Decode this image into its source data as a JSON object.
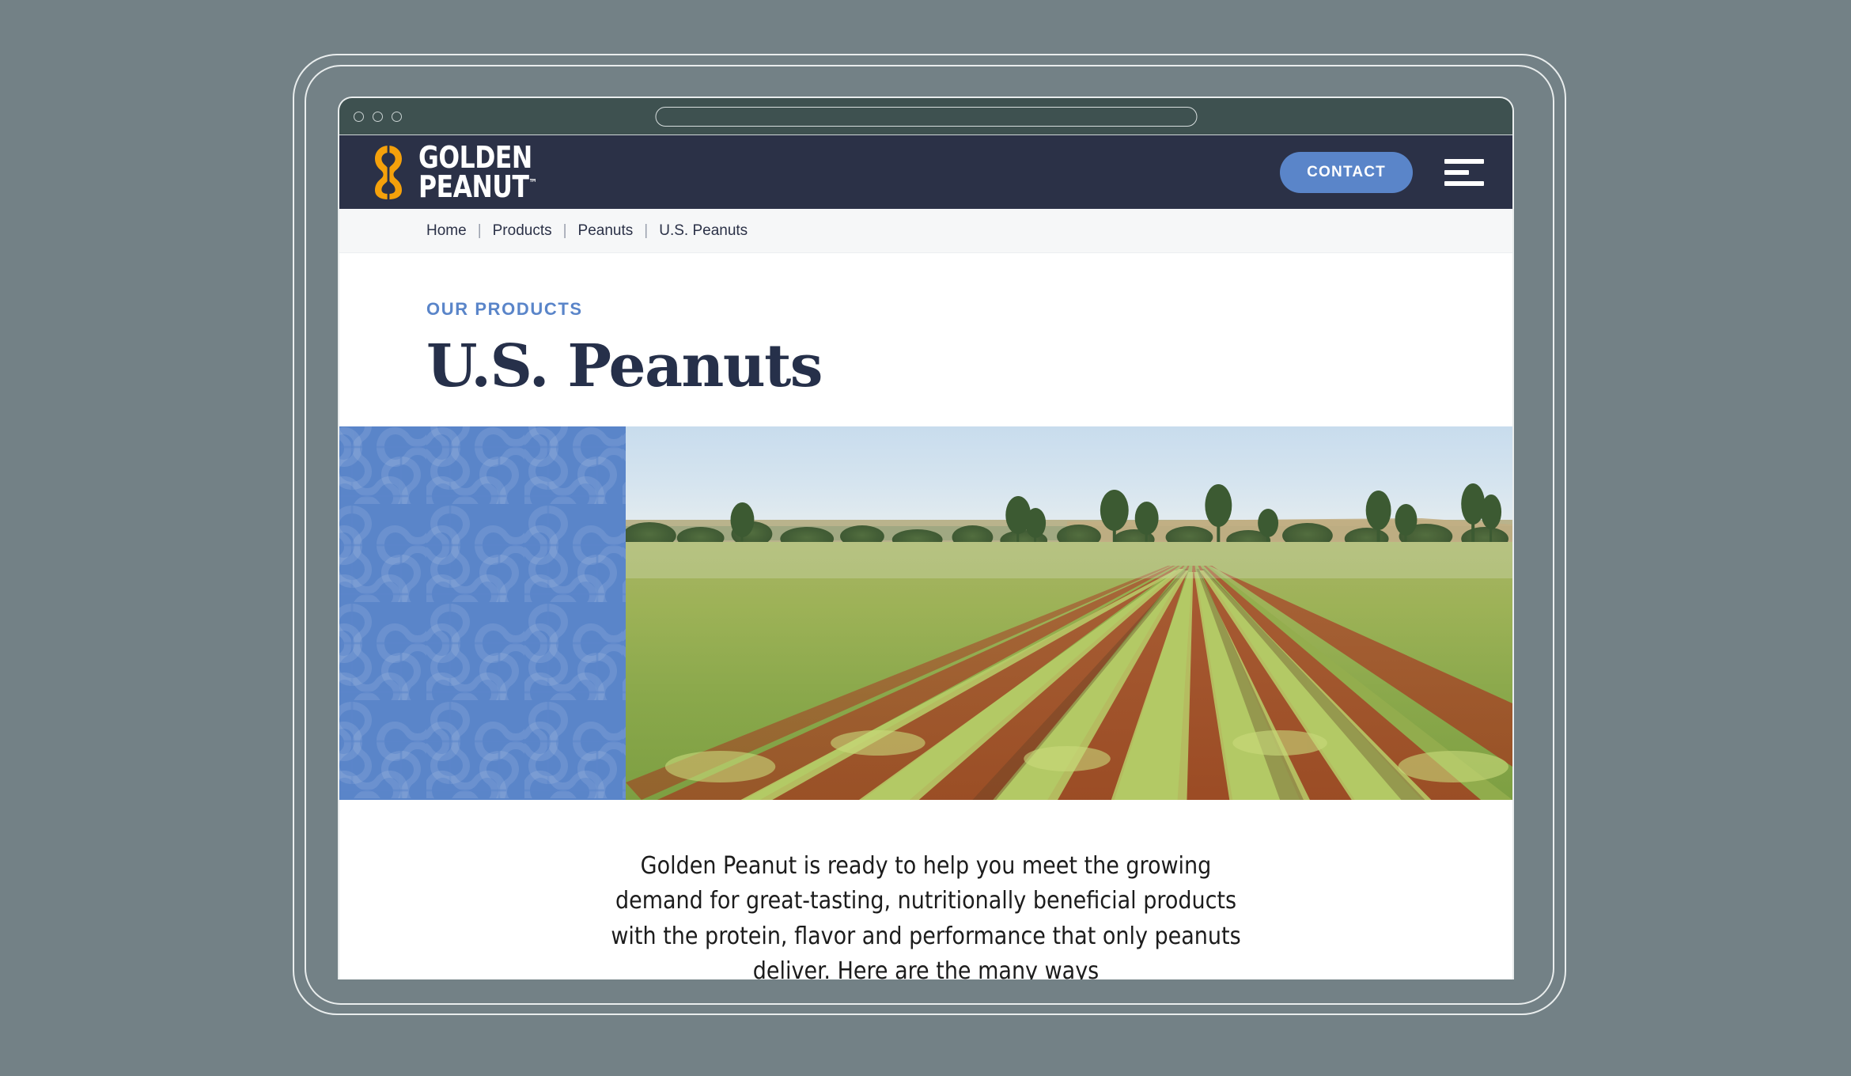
{
  "theme": {
    "page_background": "#738186",
    "device_outline": "#e9eded",
    "browser_chrome": "#3e5150",
    "nav_background": "#2b3147",
    "accent_blue": "#5a85c9",
    "brand_gold": "#f5a10b",
    "heading_navy": "#26304a",
    "breadcrumb_background": "#f6f7f8"
  },
  "browser": {
    "traffic_lights": [
      "window-close-dot",
      "window-minimize-dot",
      "window-maximize-dot"
    ],
    "address_value": "",
    "address_placeholder": ""
  },
  "nav": {
    "brand": {
      "mark": "peanut-logo-icon",
      "line1": "GOLDEN",
      "line2": "PEANUT",
      "trademark": "™"
    },
    "contact_label": "CONTACT",
    "menu_icon": "hamburger-menu-icon"
  },
  "breadcrumb": {
    "separator": "|",
    "items": [
      {
        "label": "Home",
        "current": false
      },
      {
        "label": "Products",
        "current": false
      },
      {
        "label": "Peanuts",
        "current": false
      },
      {
        "label": "U.S. Peanuts",
        "current": true
      }
    ]
  },
  "page": {
    "eyebrow": "OUR PRODUCTS",
    "title": "U.S. Peanuts"
  },
  "hero": {
    "pattern_name": "peanut-tile-pattern",
    "pattern_color": "#5a85c9",
    "photo_name": "peanut-field-rows-photo",
    "photo_alt": "Rows of green peanut plants growing in red soil with trees on the horizon"
  },
  "intro": {
    "paragraph": "Golden Peanut is ready to help you meet the growing demand for great-tasting, nutritionally beneficial products with the protein, flavor and performance that only peanuts deliver. Here are the many ways"
  }
}
